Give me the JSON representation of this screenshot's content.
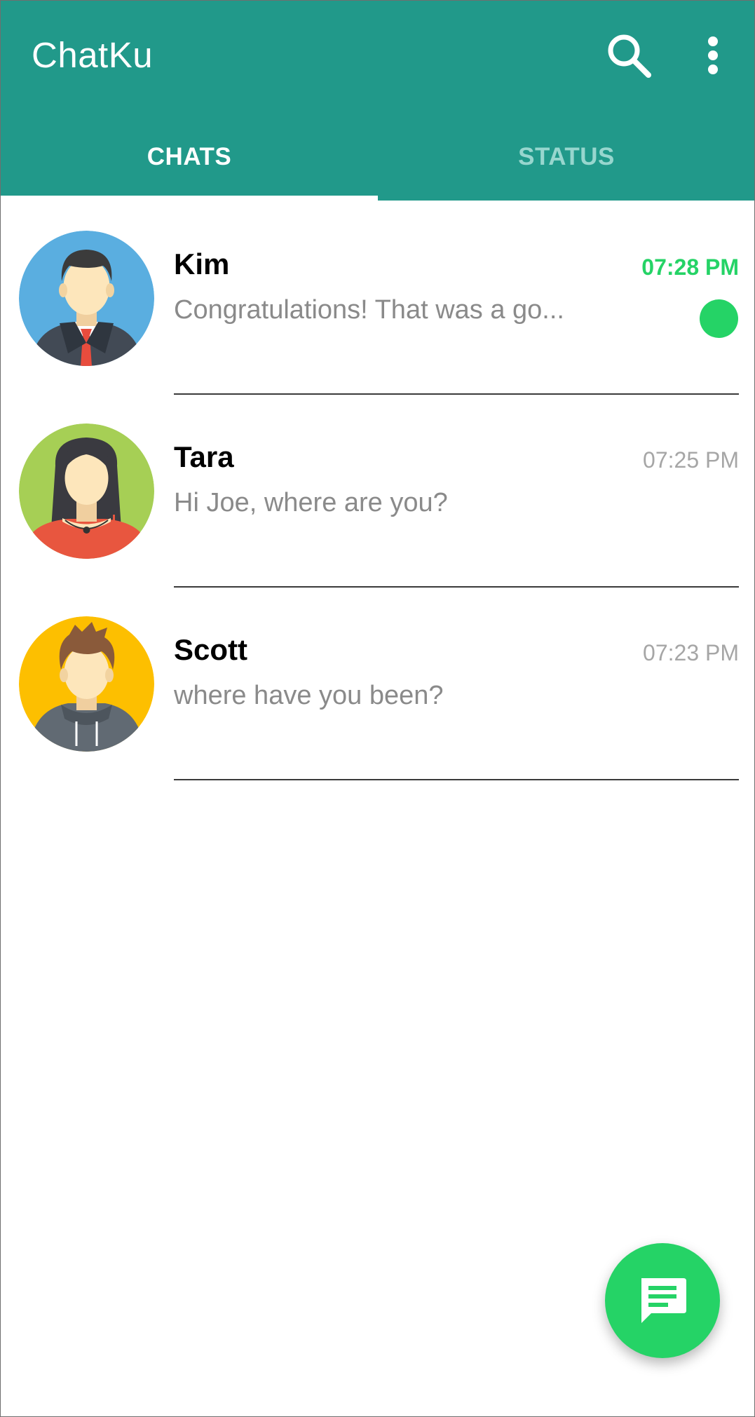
{
  "app": {
    "title": "ChatKu",
    "accent_color": "#21998a",
    "unread_color": "#25d366"
  },
  "toolbar": {
    "search_icon": "search-icon",
    "more_icon": "more-vert-icon"
  },
  "tabs": [
    {
      "label": "CHATS",
      "selected": true
    },
    {
      "label": "STATUS",
      "selected": false
    }
  ],
  "chats": [
    {
      "name": "Kim",
      "preview": "Congratulations! That was a go...",
      "time": "07:28 PM",
      "unread": true,
      "avatar": "avatar-man-suit"
    },
    {
      "name": "Tara",
      "preview": "Hi Joe, where are you?",
      "time": "07:25 PM",
      "unread": false,
      "avatar": "avatar-woman"
    },
    {
      "name": "Scott",
      "preview": "where have you been?",
      "time": "07:23 PM",
      "unread": false,
      "avatar": "avatar-man-hoodie"
    }
  ],
  "fab": {
    "icon": "new-message-icon"
  }
}
